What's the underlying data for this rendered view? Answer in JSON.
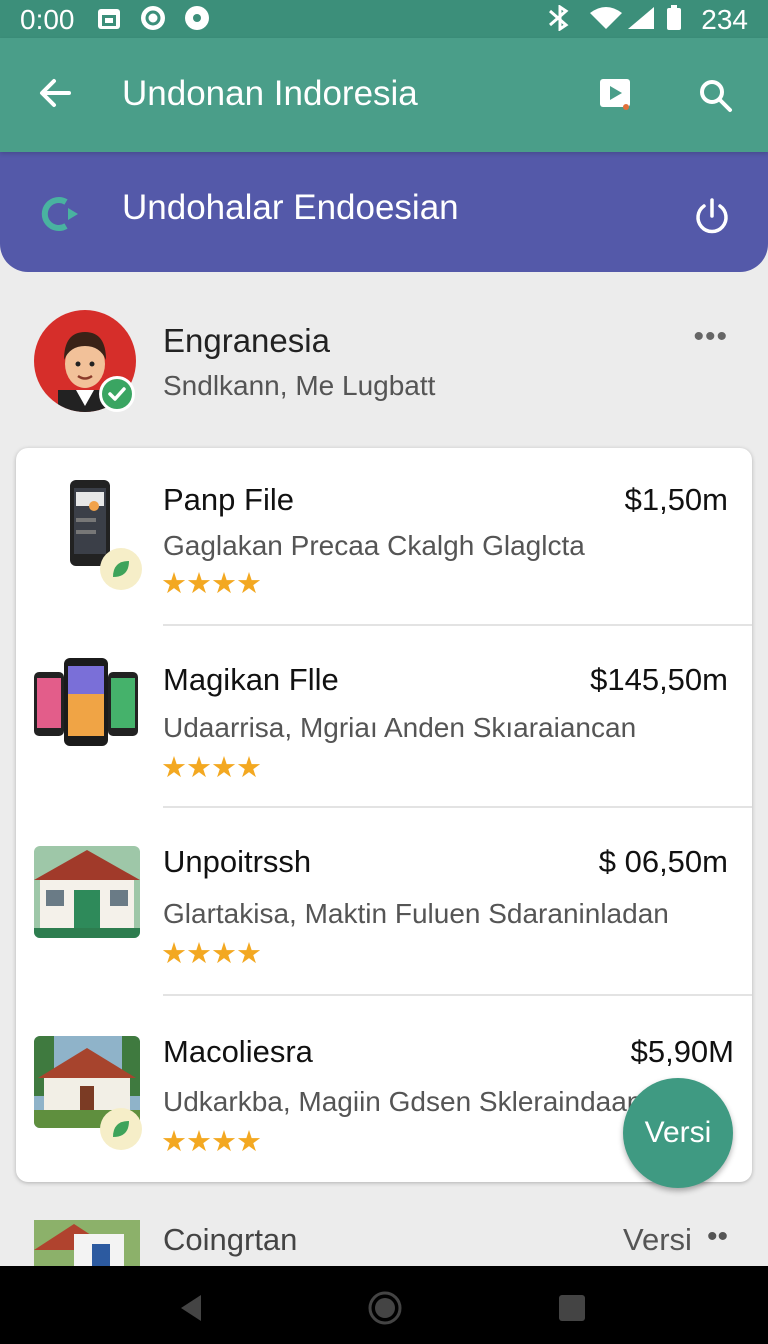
{
  "status_bar": {
    "time": "0:00",
    "battery": "234",
    "icons": [
      "calendar-icon",
      "messenger-icon",
      "record-icon",
      "bluetooth-icon",
      "wifi-icon",
      "signal-icon",
      "battery-icon"
    ]
  },
  "app_bar": {
    "title": "Undonan Indoresia",
    "icons": [
      "back-arrow-icon",
      "play-video-icon",
      "search-icon"
    ]
  },
  "banner": {
    "title": "Undohalar Endoesian",
    "icons": [
      "refresh-logo-icon",
      "power-icon"
    ]
  },
  "profile": {
    "name": "Engranesia",
    "subtitle": "Sndlkann, Me Lugbatt",
    "more": "•••"
  },
  "listings": [
    {
      "name": "Panp File",
      "price": "$1,50m",
      "description": "Gaglakan Precaa Ckalgh Glaglcta",
      "stars": "★★★★",
      "thumb": "phone"
    },
    {
      "name": "Magikan Flle",
      "price": "$145,50m",
      "description": "Udaarrisa, Mgriaı Anden Skıaraiancan",
      "stars": "★★★★",
      "thumb": "phones"
    },
    {
      "name": "Unpoitrssh",
      "price": "$ 06,50m",
      "description": "Glartakisa, Maktin Fuluen Sdaraninladan",
      "stars": "★★★★",
      "thumb": "building"
    },
    {
      "name": "Macoliesra",
      "price": "$5,90M",
      "description": "Udkarkba, Magiin Gdsen Skleraindaan",
      "stars": "★★★★",
      "thumb": "house"
    }
  ],
  "fab": {
    "label": "Versi"
  },
  "peek_row": {
    "name": "Coingrtan",
    "version": "Versi",
    "more": "••"
  },
  "colors": {
    "status_bar": "#3c8f7a",
    "app_bar": "#4a9e89",
    "banner": "#5459a9",
    "fab": "#3f9a82",
    "star": "#f3a821"
  }
}
